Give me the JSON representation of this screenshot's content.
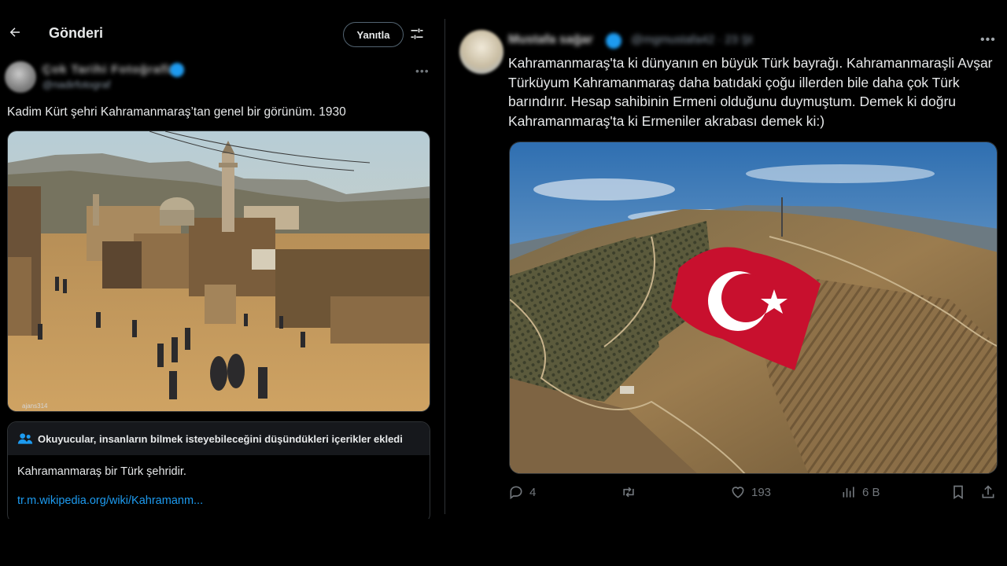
{
  "left_panel": {
    "header": {
      "title": "Gönderi",
      "reply_label": "Yanıtla"
    },
    "post": {
      "author_name": "Çok Tarihi Fotoğraflar",
      "author_handle": "@nadirfotograf",
      "text": "Kadim Kürt şehri Kahramanmaraş’tan genel bir görünüm. 1930",
      "photo_credit": "ajans314"
    },
    "community_note": {
      "title": "Okuyucular, insanların bilmek isteyebileceğini düşündükleri içerikler ekledi",
      "body": "Kahramanmaraş bir Türk şehridir.",
      "link": "tr.m.wikipedia.org/wiki/Kahramanm..."
    }
  },
  "right_panel": {
    "post": {
      "author_name": "Mustafa sağar",
      "author_handle": "@mgmustafa42 · 23 Şt",
      "text": "Kahramanmaraş'ta ki dünyanın en büyük Türk bayrağı. Kahramanmaraşli Avşar Türküyum Kahramanmaraş daha batıdaki çoğu illerden bile daha çok Türk barındırır. Hesap sahibinin Ermeni olduğunu duymuştum. Demek ki doğru Kahramanmaraş'ta ki Ermeniler akrabası demek ki:)"
    },
    "actions": {
      "replies": "4",
      "likes": "193",
      "views": "6 B"
    }
  },
  "colors": {
    "background": "#000000",
    "text": "#e7e9ea",
    "muted": "#71767b",
    "accent": "#1d9bf0",
    "border": "#2f3336",
    "note_header_bg": "#16181c",
    "flag_red": "#c8102e"
  },
  "icons": [
    "back-arrow-icon",
    "settings-sliders-icon",
    "more-icon",
    "verified-icon",
    "people-icon",
    "reply-icon",
    "retweet-icon",
    "like-icon",
    "views-icon",
    "bookmark-icon",
    "share-icon"
  ]
}
